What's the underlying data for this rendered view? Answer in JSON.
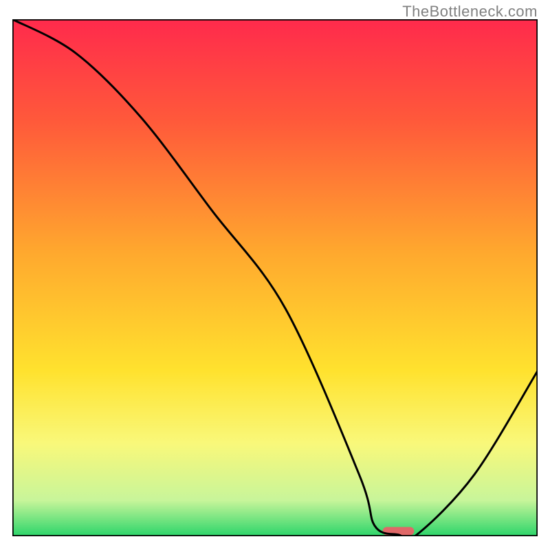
{
  "watermark": "TheBottleneck.com",
  "chart_data": {
    "type": "line",
    "title": "",
    "xlabel": "",
    "ylabel": "",
    "xlim": [
      0,
      100
    ],
    "ylim": [
      0,
      100
    ],
    "grid": false,
    "legend": false,
    "background_gradient": {
      "stops": [
        {
          "offset": 0.0,
          "color": "#ff2a4c"
        },
        {
          "offset": 0.2,
          "color": "#ff5a3a"
        },
        {
          "offset": 0.45,
          "color": "#ffa82e"
        },
        {
          "offset": 0.68,
          "color": "#ffe22e"
        },
        {
          "offset": 0.82,
          "color": "#f9f87a"
        },
        {
          "offset": 0.93,
          "color": "#c8f59a"
        },
        {
          "offset": 1.0,
          "color": "#2bd56a"
        }
      ]
    },
    "series": [
      {
        "name": "bottleneck-curve",
        "color": "#000000",
        "x": [
          0.0,
          12.0,
          24.5,
          38.0,
          52.0,
          66.0,
          69.0,
          73.5,
          77.0,
          88.0,
          100.0
        ],
        "y": [
          100.0,
          93.5,
          81.0,
          63.0,
          44.0,
          12.0,
          2.0,
          0.3,
          0.3,
          12.0,
          32.0
        ]
      }
    ],
    "markers": [
      {
        "name": "sweet-spot",
        "shape": "rounded-rect",
        "color": "#e06868",
        "x_range": [
          70.5,
          76.5
        ],
        "y": 0.2,
        "height": 1.6
      }
    ]
  }
}
